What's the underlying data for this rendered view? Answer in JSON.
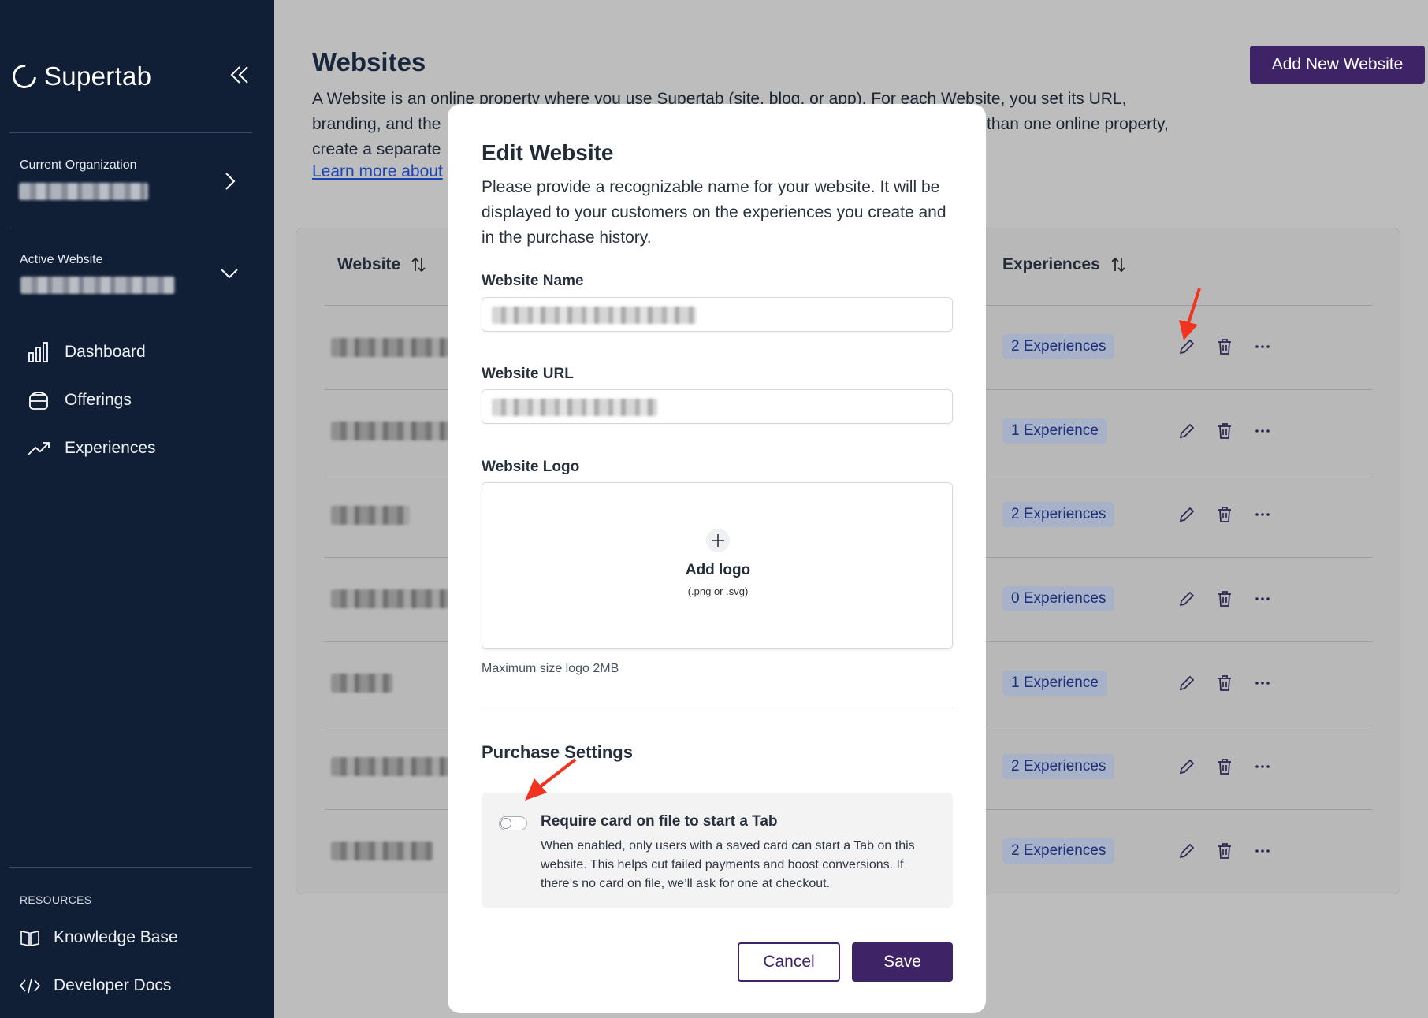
{
  "sidebar": {
    "brand": "Supertab",
    "current_org_label": "Current Organization",
    "active_website_label": "Active Website",
    "nav": [
      {
        "label": "Dashboard",
        "icon": "bar-chart-icon"
      },
      {
        "label": "Offerings",
        "icon": "stack-icon"
      },
      {
        "label": "Experiences",
        "icon": "trending-up-icon"
      }
    ],
    "resources_label": "RESOURCES",
    "resources": [
      {
        "label": "Knowledge Base",
        "icon": "book-icon"
      },
      {
        "label": "Developer Docs",
        "icon": "code-icon"
      }
    ]
  },
  "main": {
    "title": "Websites",
    "description_lines": [
      "A Website is an online property where you use Supertab (site, blog, or app). For each Website, you set its URL,",
      "branding, and the",
      "create a separate"
    ],
    "description_right": "than one online property,",
    "learn_more": "Learn more about",
    "add_button": "Add New Website",
    "table": {
      "col_website": "Website",
      "col_experiences": "Experiences",
      "rows": [
        {
          "experiences": "2 Experiences"
        },
        {
          "experiences": "1 Experience"
        },
        {
          "experiences": "2 Experiences"
        },
        {
          "experiences": "0 Experiences"
        },
        {
          "experiences": "1 Experience"
        },
        {
          "experiences": "2 Experiences"
        },
        {
          "experiences": "2 Experiences"
        }
      ]
    }
  },
  "modal": {
    "title": "Edit Website",
    "description": "Please provide a recognizable name for your website. It will be displayed to your customers on the experiences you create and in the purchase history.",
    "name_label": "Website Name",
    "url_label": "Website URL",
    "logo_label": "Website Logo",
    "add_logo": "Add logo",
    "logo_types": "(.png or .svg)",
    "max_size": "Maximum size logo 2MB",
    "purchase_settings": "Purchase Settings",
    "toggle_title": "Require card on file to start a Tab",
    "toggle_desc": "When enabled, only users with a saved card can start a Tab on this website. This helps cut failed payments and boost conversions. If there’s no card on file, we’ll ask for one at checkout.",
    "toggle_on": false,
    "cancel": "Cancel",
    "save": "Save"
  },
  "colors": {
    "sidebar_bg": "#101f36",
    "primary": "#3e2466",
    "badge_text": "#1d2e7a",
    "annotation_arrow": "#f0341f"
  }
}
